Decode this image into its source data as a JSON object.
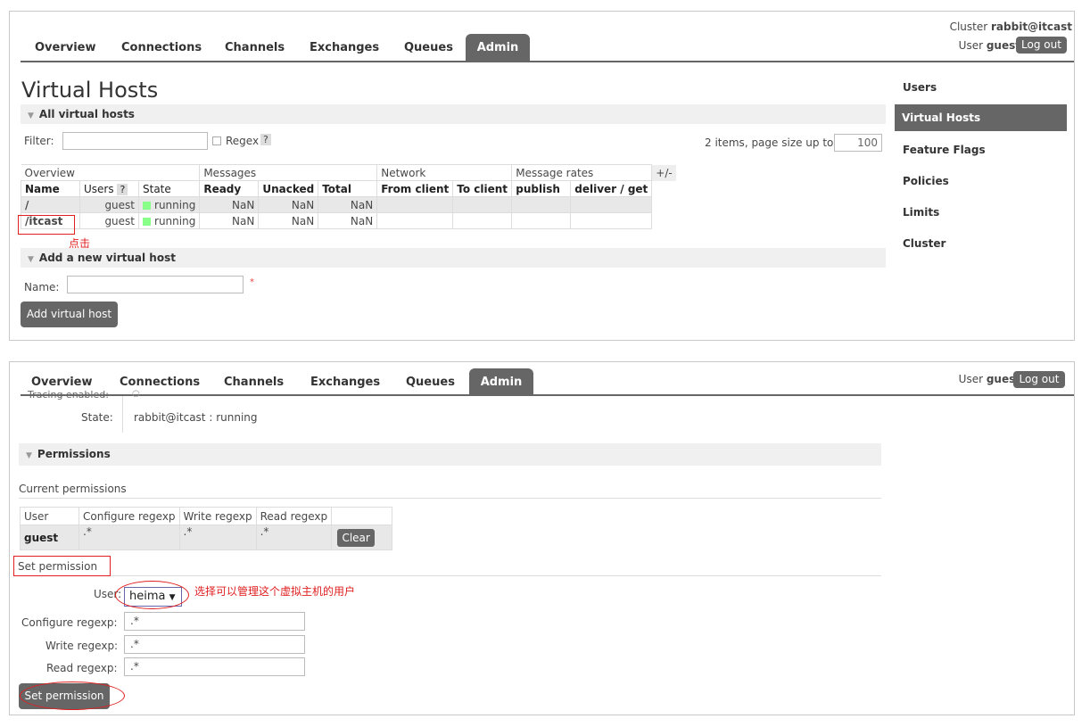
{
  "top": {
    "cluster_label": "Cluster",
    "cluster_name": "rabbit@itcast",
    "user_label": "User",
    "user_name": "guest",
    "logout": "Log out"
  },
  "tabs": [
    "Overview",
    "Connections",
    "Channels",
    "Exchanges",
    "Queues",
    "Admin"
  ],
  "page_title": "Virtual Hosts",
  "all_vhosts": {
    "header": "All virtual hosts",
    "filter_label": "Filter:",
    "regex_label": "Regex",
    "help": "?",
    "items_text": "2 items, page size up to",
    "page_size": "100",
    "group_headers": [
      "Overview",
      "Messages",
      "Network",
      "Message rates"
    ],
    "plus_minus": "+/-",
    "col_headers": [
      "Name",
      "Users",
      "State",
      "Ready",
      "Unacked",
      "Total",
      "From client",
      "To client",
      "publish",
      "deliver / get"
    ],
    "rows": [
      {
        "name": "/",
        "users": "guest",
        "state": "running",
        "ready": "NaN",
        "unacked": "NaN",
        "total": "NaN"
      },
      {
        "name": "/itcast",
        "users": "guest",
        "state": "running",
        "ready": "NaN",
        "unacked": "NaN",
        "total": "NaN"
      }
    ],
    "annotation_click": "点击"
  },
  "add_vhost": {
    "header": "Add a new virtual host",
    "name_label": "Name:",
    "required": "*",
    "button": "Add virtual host"
  },
  "sidebar": [
    "Users",
    "Virtual Hosts",
    "Feature Flags",
    "Policies",
    "Limits",
    "Cluster"
  ],
  "detail": {
    "cut_label": "Tracing enabled:",
    "cut_value": "○",
    "state_label": "State:",
    "state_node": "rabbit@itcast",
    "state_value": ": running",
    "permissions_header": "Permissions",
    "current_permissions": "Current permissions",
    "perm_cols": [
      "User",
      "Configure regexp",
      "Write regexp",
      "Read regexp"
    ],
    "perm_row": {
      "user": "guest",
      "configure": ".*",
      "write": ".*",
      "read": ".*"
    },
    "clear": "Clear",
    "set_permission_title": "Set permission",
    "user_label": "User:",
    "user_select": "heima",
    "annotation_select": "选择可以管理这个虚拟主机的用户",
    "configure_label": "Configure regexp:",
    "configure_value": ".*",
    "write_label": "Write regexp:",
    "write_value": ".*",
    "read_label": "Read regexp:",
    "read_value": ".*",
    "set_button": "Set permission"
  }
}
